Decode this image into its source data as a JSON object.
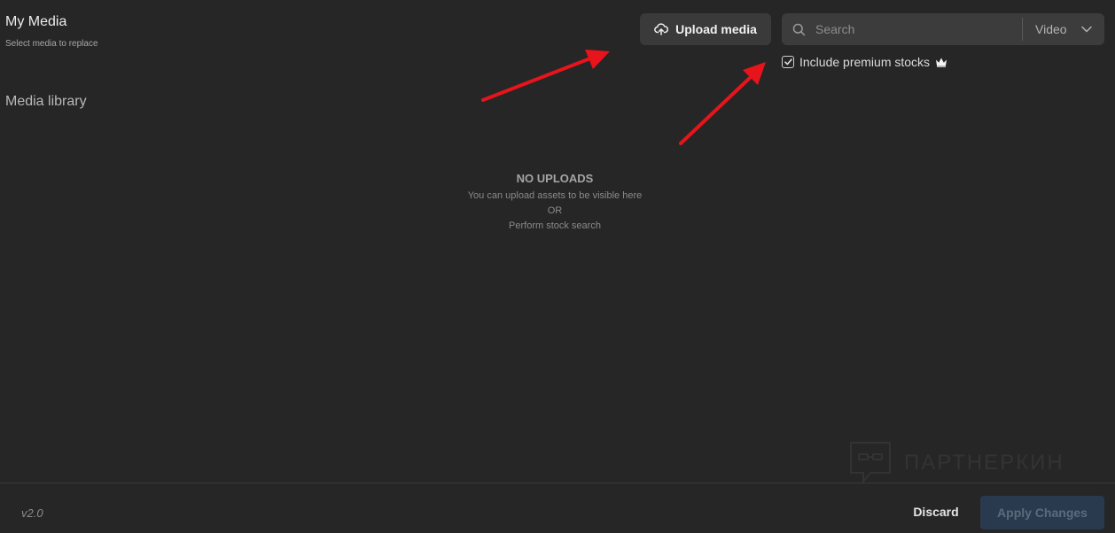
{
  "header": {
    "title": "My Media",
    "subtitle": "Select media to replace"
  },
  "section": {
    "title": "Media library"
  },
  "upload": {
    "label": "Upload media",
    "icon": "cloud-upload-icon"
  },
  "search": {
    "placeholder": "Search",
    "value": "",
    "icon": "search-icon"
  },
  "type_select": {
    "selected": "Video",
    "icon": "chevron-down-icon"
  },
  "premium": {
    "label": "Include premium stocks",
    "checked": true,
    "icon": "crown-icon"
  },
  "empty_state": {
    "title": "NO UPLOADS",
    "line1": "You can upload assets to be visible here",
    "line2": "OR",
    "line3": "Perform stock search"
  },
  "watermark": {
    "text": "ПАРТНЕРКИН"
  },
  "footer": {
    "version": "v2.0",
    "discard_label": "Discard",
    "apply_label": "Apply Changes"
  },
  "colors": {
    "background": "#262626",
    "annotation_arrow": "#e8141b",
    "apply_bg": "#2a3a4e"
  }
}
